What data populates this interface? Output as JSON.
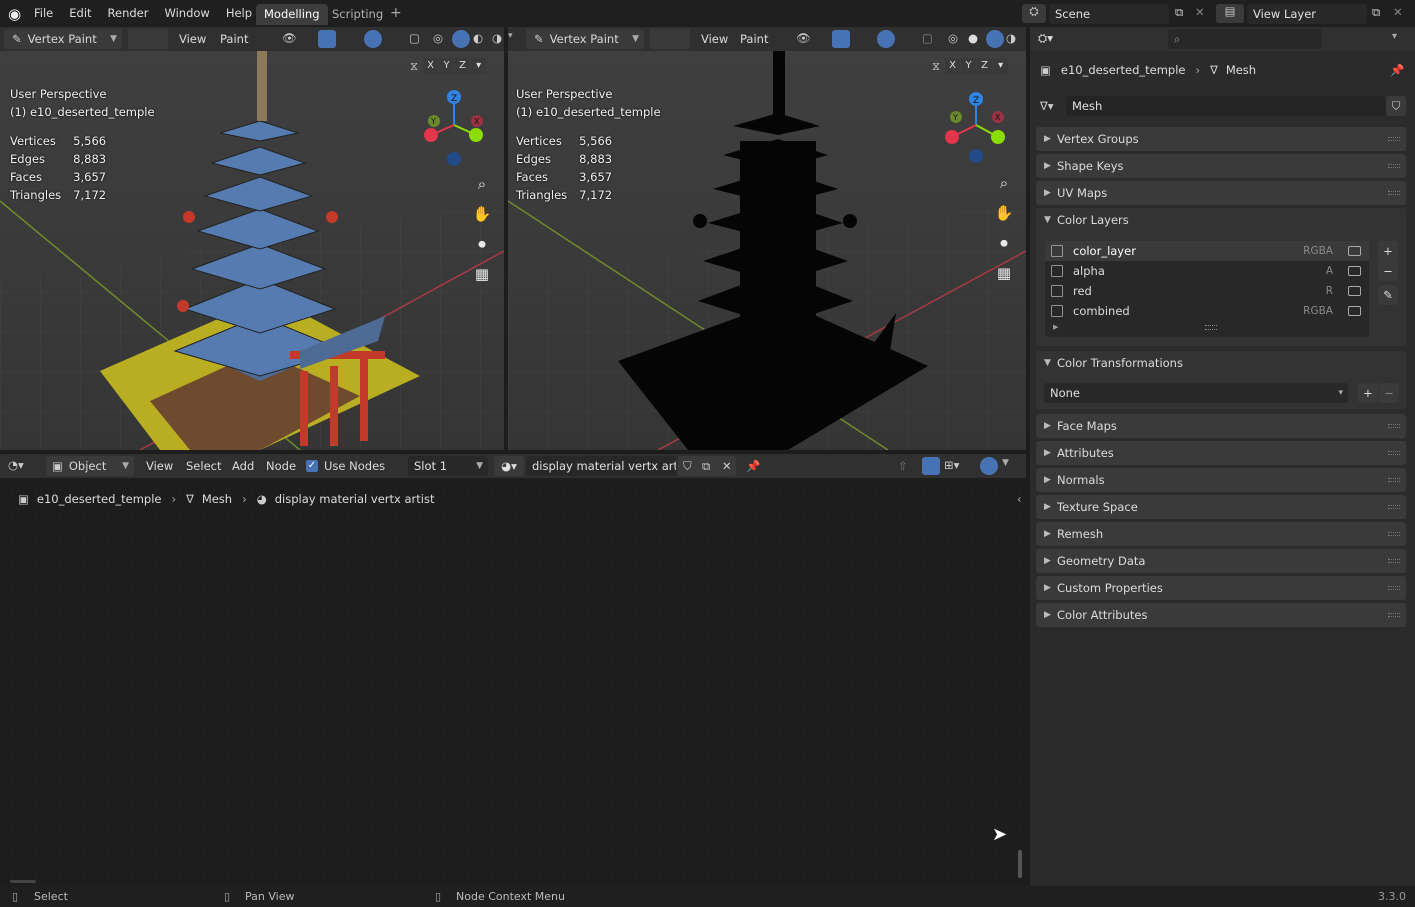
{
  "topbar": {
    "menus": [
      "File",
      "Edit",
      "Render",
      "Window",
      "Help"
    ],
    "tabs": [
      "Modelling",
      "Scripting"
    ],
    "add_tab": "+",
    "scene": "Scene",
    "view_layer": "View Layer"
  },
  "viewport_left": {
    "mode": "Vertex Paint",
    "menus": [
      "View",
      "Paint"
    ],
    "perspective": "User Perspective",
    "object": "(1) e10_deserted_temple",
    "stats": [
      {
        "label": "Vertices",
        "value": "5,566"
      },
      {
        "label": "Edges",
        "value": "8,883"
      },
      {
        "label": "Faces",
        "value": "3,657"
      },
      {
        "label": "Triangles",
        "value": "7,172"
      }
    ],
    "axes": [
      "X",
      "Y",
      "Z"
    ],
    "gizmo": {
      "z": "Z",
      "y": "Y",
      "x": "X"
    }
  },
  "viewport_right": {
    "mode": "Vertex Paint",
    "menus": [
      "View",
      "Paint"
    ],
    "perspective": "User Perspective",
    "object": "(1) e10_deserted_temple",
    "stats": [
      {
        "label": "Vertices",
        "value": "5,566"
      },
      {
        "label": "Edges",
        "value": "8,883"
      },
      {
        "label": "Faces",
        "value": "3,657"
      },
      {
        "label": "Triangles",
        "value": "7,172"
      }
    ],
    "axes": [
      "X",
      "Y",
      "Z"
    ],
    "gizmo": {
      "z": "Z",
      "y": "Y",
      "x": "X"
    }
  },
  "node_editor": {
    "mode": "Object",
    "menus": [
      "View",
      "Select",
      "Add",
      "Node"
    ],
    "use_nodes": "Use Nodes",
    "slot": "Slot 1",
    "material": "display material vertx artist",
    "breadcrumb": {
      "object": "e10_deserted_temple",
      "mesh": "Mesh",
      "material": "display material vertx artist"
    }
  },
  "properties": {
    "breadcrumb": {
      "object": "e10_deserted_temple",
      "mesh": "Mesh"
    },
    "mesh_name": "Mesh",
    "panels_top": [
      "Vertex Groups",
      "Shape Keys",
      "UV Maps"
    ],
    "color_layers_title": "Color Layers",
    "color_layers": [
      {
        "name": "color_layer",
        "type": "RGBA"
      },
      {
        "name": "alpha",
        "type": "A"
      },
      {
        "name": "red",
        "type": "R"
      },
      {
        "name": "combined",
        "type": "RGBA"
      }
    ],
    "color_transform_title": "Color Transformations",
    "color_transform_value": "None",
    "panels_bottom": [
      "Face Maps",
      "Attributes",
      "Normals",
      "Texture Space",
      "Remesh",
      "Geometry Data",
      "Custom Properties",
      "Color Attributes"
    ]
  },
  "statusbar": {
    "select": "Select",
    "pan": "Pan View",
    "context": "Node Context Menu",
    "version": "3.3.0"
  },
  "colors": {
    "accent_blue": "#4772b3",
    "axis_x": "#e3354c",
    "axis_y": "#8bdc00",
    "axis_z": "#2f83e3"
  }
}
